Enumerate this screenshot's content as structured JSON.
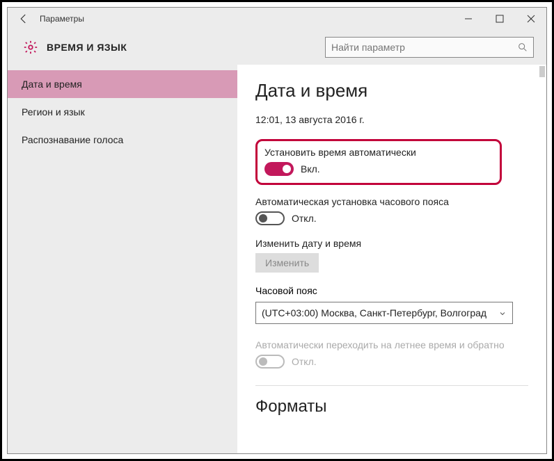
{
  "window": {
    "title": "Параметры"
  },
  "header": {
    "page_title": "ВРЕМЯ И ЯЗЫК"
  },
  "search": {
    "placeholder": "Найти параметр"
  },
  "sidebar": {
    "items": [
      {
        "label": "Дата и время",
        "active": true
      },
      {
        "label": "Регион и язык",
        "active": false
      },
      {
        "label": "Распознавание голоса",
        "active": false
      }
    ]
  },
  "main": {
    "title": "Дата и время",
    "current_datetime": "12:01, 13 августа 2016 г.",
    "auto_time": {
      "label": "Установить время автоматически",
      "state_label": "Вкл.",
      "on": true
    },
    "auto_tz": {
      "label": "Автоматическая установка часового пояса",
      "state_label": "Откл.",
      "on": false
    },
    "change_dt": {
      "label": "Изменить дату и время",
      "button": "Изменить"
    },
    "timezone": {
      "label": "Часовой пояс",
      "value": "(UTC+03:00) Москва, Санкт-Петербург, Волгоград"
    },
    "dst": {
      "label": "Автоматически переходить на летнее время и обратно",
      "state_label": "Откл.",
      "on": false,
      "disabled": true
    },
    "formats_title": "Форматы"
  },
  "colors": {
    "accent": "#c2185b",
    "highlight_border": "#c2003a",
    "sidebar_active": "#d89ab6"
  }
}
